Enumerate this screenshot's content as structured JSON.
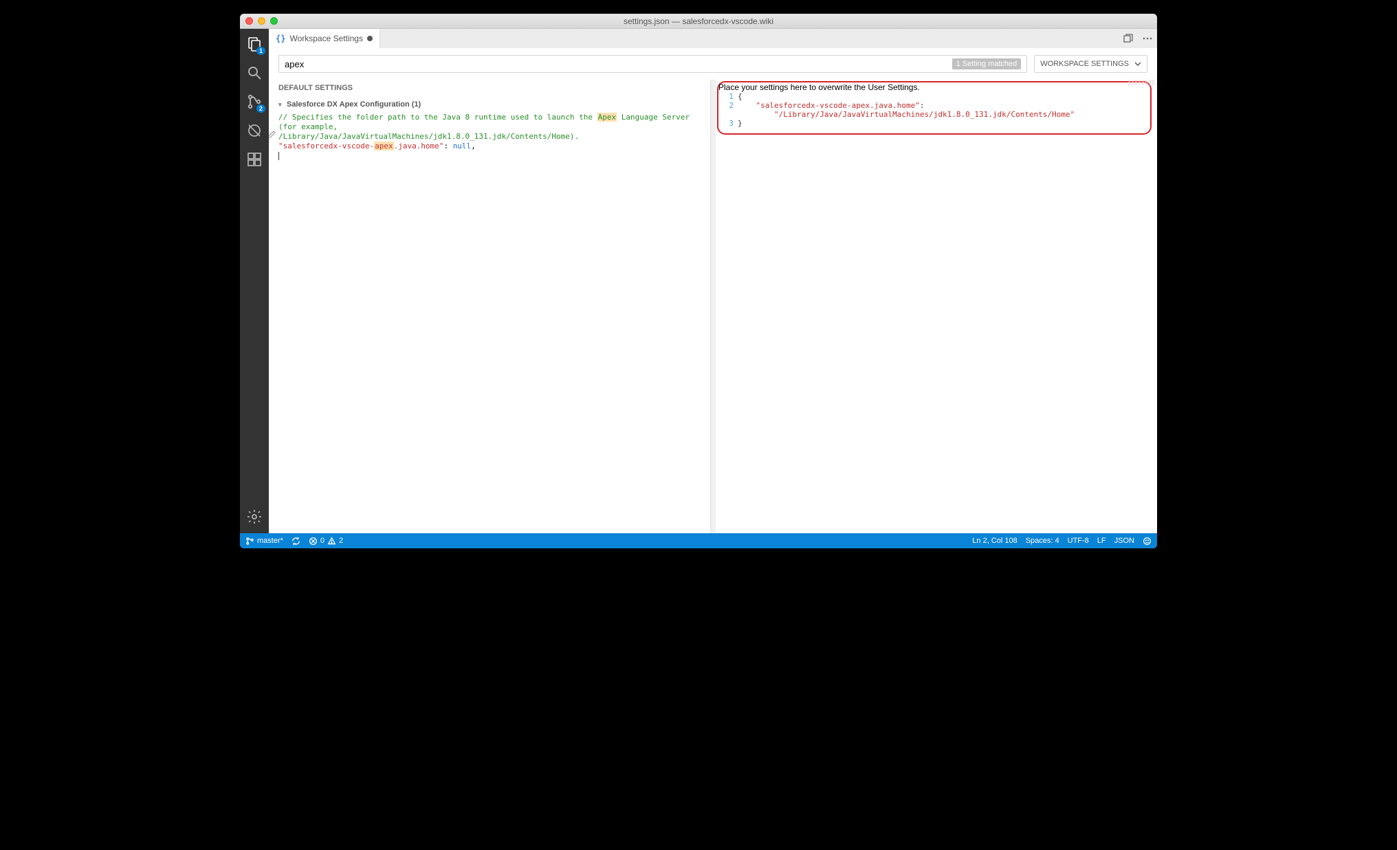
{
  "title": "settings.json — salesforcedx-vscode.wiki",
  "tab": {
    "label": "Workspace Settings"
  },
  "search": {
    "value": "apex",
    "match": "1 Setting matched"
  },
  "scope": {
    "label": "WORKSPACE SETTINGS"
  },
  "left": {
    "header": "DEFAULT SETTINGS",
    "section": "Salesforce DX Apex Configuration (1)",
    "comment1": "// Specifies the folder path to the Java 8 runtime used to launch the ",
    "comment1_hl": "Apex",
    "comment1_tail": " Language Server (for example,",
    "comment2": "/Library/Java/JavaVirtualMachines/jdk1.8.0_131.jdk/Contents/Home).",
    "key_p1": "\"salesforcedx-vscode-",
    "key_hl": "apex",
    "key_p2": ".java.home\"",
    "null": "null"
  },
  "right": {
    "hint": "Place your settings here to overwrite the User Settings.",
    "line1_num": "1",
    "line1": "{",
    "line2_num": "2",
    "line2_indent": "    ",
    "line2_key": "\"salesforcedx-vscode-apex.java.home\"",
    "line2_colon": ":",
    "line2b_indent": "        ",
    "line2b_val": "\"/Library/Java/JavaVirtualMachines/jdk1.8.0_131.jdk/Contents/Home\"",
    "line3_num": "3",
    "line3": "}"
  },
  "status": {
    "branch": "master*",
    "errors": "0",
    "warnings": "2",
    "ln": "Ln 2, Col 108",
    "spaces": "Spaces: 4",
    "encoding": "UTF-8",
    "eol": "LF",
    "lang": "JSON"
  },
  "activity": {
    "files_badge": "1",
    "scm_badge": "2"
  }
}
